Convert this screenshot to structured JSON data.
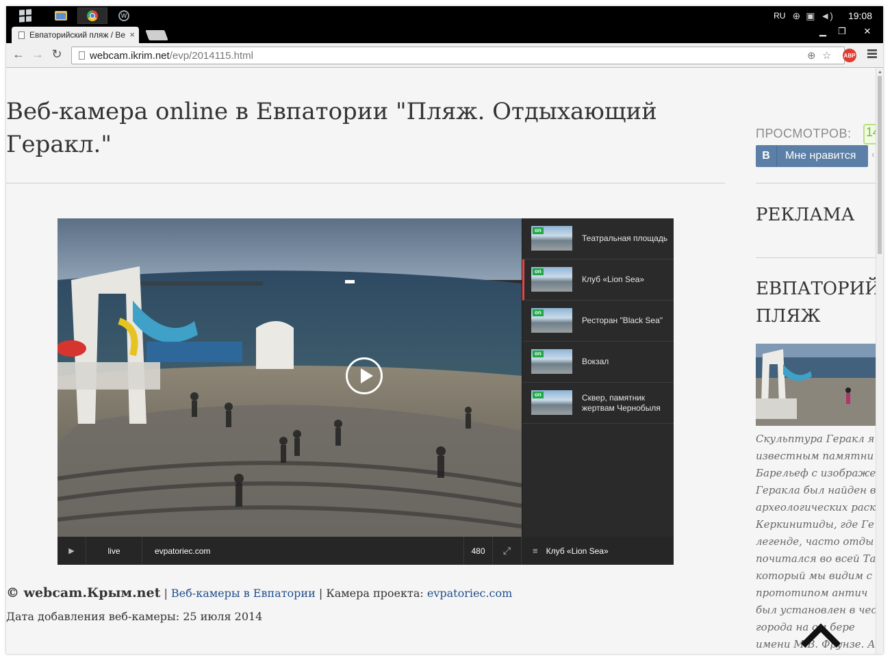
{
  "taskbar": {
    "language": "RU",
    "clock": "19:08"
  },
  "browser": {
    "tab_title": "Евпаторийский пляж / Ве",
    "url_host": "webcam.ikrim.net",
    "url_path": "/evp/2014115.html",
    "adblock_label": "ABP"
  },
  "page": {
    "title": "Веб-камера online в Евпатории \"Пляж. Отдыхающий Геракл.\"",
    "player": {
      "playlist": [
        {
          "label": "Театральная площадь",
          "status": "on"
        },
        {
          "label": "Клуб «Lion Sea»",
          "status": "on"
        },
        {
          "label": "Ресторан \"Black Sea\"",
          "status": "on"
        },
        {
          "label": "Вокзал",
          "status": "on"
        },
        {
          "label": "Сквер, памятник жертвам Чернобыля",
          "status": "on"
        }
      ],
      "controls": {
        "live": "live",
        "source": "evpatoriec.com",
        "quality": "480",
        "current_camera": "Клуб «Lion Sea»"
      }
    },
    "footer": {
      "brand": "© webcam.Крым.net",
      "sep1": " | ",
      "link1": "Веб-камеры в Евпатории",
      "sep2": " | Камера проекта: ",
      "link2": "evpatoriec.com"
    },
    "added": "Дата добавления веб-камеры: 25 июля 2014"
  },
  "sidebar": {
    "views_label": "ПРОСМОТРОВ:",
    "views_count": "14",
    "vk_button": "Мне нравится",
    "vk_letter": "B",
    "ad_heading": "РЕКЛАМА",
    "section_heading_line1": "ЕВПАТОРИЙ",
    "section_heading_line2": "ПЛЯЖ",
    "description_lines": [
      "Скульптура Геракл я",
      "известным памятни",
      "Барельеф с изображе",
      "Геракла был найден в",
      "археологических раск",
      "Керкинитиды, где Ге",
      "легенде, часто отды",
      "почитался во всей Та",
      "который мы видим с",
      "прототипом антич",
      "был установлен в чес",
      "города на    ом бере",
      "имени М.В. Фрунзе. А"
    ]
  },
  "colors": {
    "accent_active": "#e84646",
    "link": "#1f4e8c",
    "vk": "#5b7fa6",
    "online_badge": "#1fa845"
  }
}
